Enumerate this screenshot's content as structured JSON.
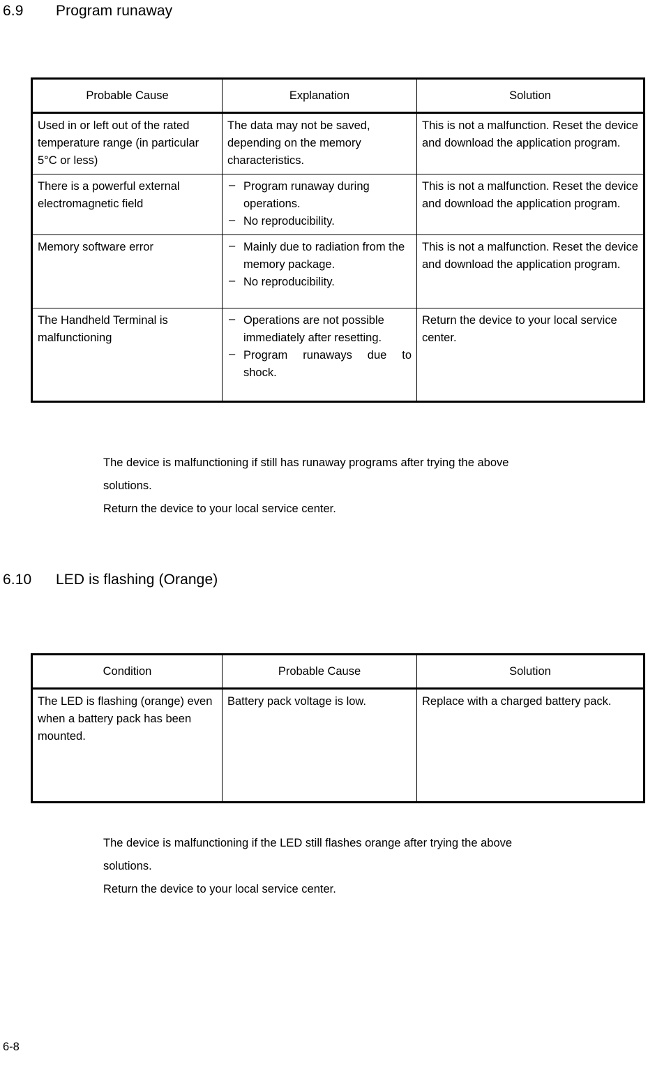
{
  "page": {
    "number": "6-8"
  },
  "sections": [
    {
      "number": "6.9",
      "title": "Program runaway"
    },
    {
      "number": "6.10",
      "title": "LED is flashing (Orange)"
    }
  ],
  "table_runaway": {
    "headers": [
      "Probable Cause",
      "Explanation",
      "Solution"
    ],
    "rows": [
      {
        "cause": "Used in or left out of the rated temperature range (in particular 5°C or less)",
        "explanation_text": "The data may not be saved, depending on the memory characteristics.",
        "explanation_bullets": [],
        "solution": "This is not a malfunction. Reset the device and download the application program."
      },
      {
        "cause": "There is a powerful external electromagnetic field",
        "explanation_text": "",
        "explanation_bullets": [
          "Program runaway during operations.",
          "No reproducibility."
        ],
        "solution": "This is not a malfunction. Reset the device and download the application program."
      },
      {
        "cause": "Memory software error",
        "explanation_text": "",
        "explanation_bullets": [
          "Mainly due to radiation from the memory package.",
          "No reproducibility."
        ],
        "solution": "This is not a malfunction. Reset the device and download the application program."
      },
      {
        "cause": "The Handheld Terminal is malfunctioning",
        "explanation_text": "",
        "explanation_bullets": [
          "Operations are not possible immediately after resetting.",
          "Program runaways due to shock."
        ],
        "solution": "Return the device to your local service center."
      }
    ]
  },
  "table_led": {
    "headers": [
      "Condition",
      "Probable Cause",
      "Solution"
    ],
    "rows": [
      {
        "condition": "The LED is flashing (orange) even when a battery pack has been mounted.",
        "cause": "Battery pack voltage is low.",
        "solution": "Replace with a charged battery pack."
      }
    ]
  },
  "note_runaway": {
    "line1": "The device is malfunctioning if still has runaway programs after trying the above",
    "line2": "solutions.",
    "line3": "Return the device to your local service center."
  },
  "note_led": {
    "line1": "The device is malfunctioning if the LED still flashes orange after trying the above",
    "line2": "solutions.",
    "line3": "Return the device to your local service center."
  },
  "glyphs": {
    "dash_bullet": "–"
  }
}
